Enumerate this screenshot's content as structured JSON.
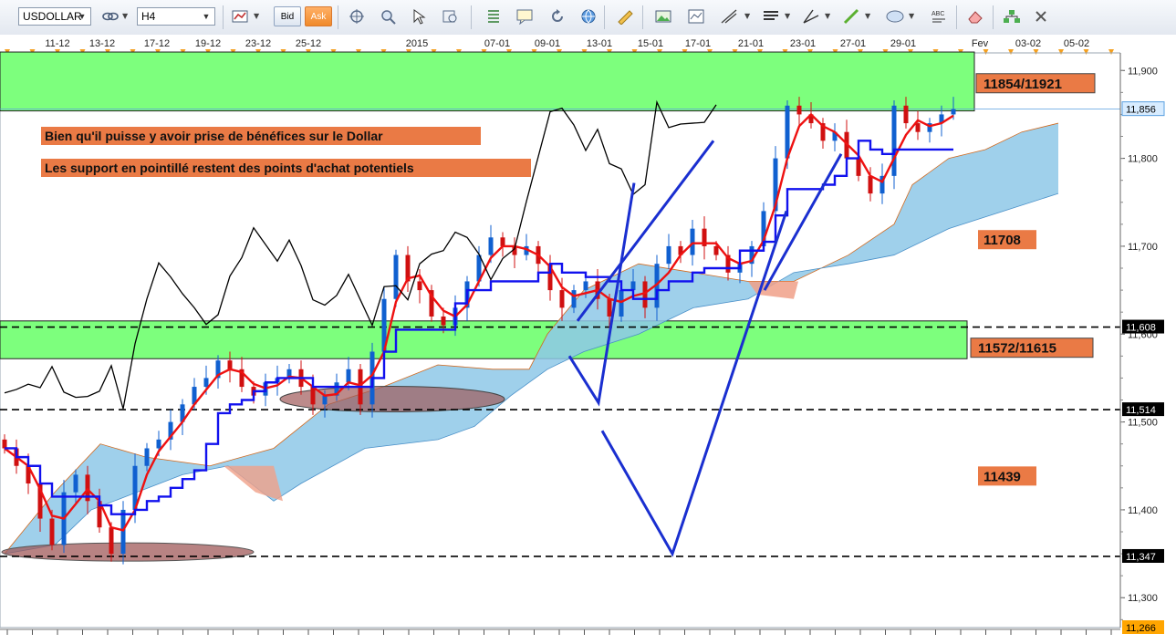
{
  "toolbar": {
    "symbol": "USDOLLAR",
    "timeframe": "H4",
    "bid_label": "Bid",
    "ask_label": "Ask",
    "icons": [
      "link-icon",
      "candles-icon",
      "crosshair-icon",
      "zoom-icon",
      "magnify-icon",
      "cursor-icon",
      "fibonacci-icon",
      "comment-icon",
      "refresh-icon",
      "globe-icon",
      "ruler-icon",
      "image-icon",
      "template-icon",
      "draw-lines-icon",
      "indicators-icon",
      "trendline-icon",
      "pencil-icon",
      "ellipse-icon",
      "text-icon",
      "eraser-icon",
      "hierarchy-icon",
      "close-icon"
    ]
  },
  "chart_data": {
    "type": "candlestick",
    "symbol": "USDOLLAR",
    "timeframe": "H4",
    "x_tick_labels": [
      "11-12",
      "13-12",
      "17-12",
      "19-12",
      "23-12",
      "25-12",
      "2015",
      "07-01",
      "09-01",
      "13-01",
      "15-01",
      "17-01",
      "21-01",
      "23-01",
      "27-01",
      "29-01",
      "Fev",
      "03-02",
      "05-02"
    ],
    "y_axis": {
      "min": 11266,
      "max": 11920,
      "ticks": [
        11900,
        11800,
        11700,
        11600,
        11500,
        11400,
        11300
      ]
    },
    "price_tags": [
      {
        "value": 11856,
        "label": "11,856",
        "style": "current"
      },
      {
        "value": 11608,
        "label": "11,608",
        "style": "level"
      },
      {
        "value": 11514,
        "label": "11,514",
        "style": "level"
      },
      {
        "value": 11347,
        "label": "11,347",
        "style": "level"
      },
      {
        "value": 11266,
        "label": "11,266",
        "style": "bottom"
      }
    ],
    "zones": [
      {
        "label": "11854/11921",
        "low": 11854,
        "high": 11921,
        "color": "#7dff7d"
      },
      {
        "label": "11572/11615",
        "low": 11572,
        "high": 11615,
        "color": "#7dff7d"
      }
    ],
    "dashed_levels": [
      11608,
      11514,
      11347
    ],
    "level_labels": [
      {
        "text": "11708",
        "value": 11708
      },
      {
        "text": "11439",
        "value": 11439
      }
    ],
    "annotations": [
      "Bien qu'il puisse y avoir prise de bénéfices sur le Dollar",
      "Les support en pointillé restent des points d'achat potentiels"
    ],
    "close_series": [
      11470,
      11450,
      11430,
      11390,
      11360,
      11420,
      11440,
      11410,
      11380,
      11350,
      11400,
      11450,
      11470,
      11480,
      11500,
      11520,
      11540,
      11550,
      11570,
      11560,
      11540,
      11530,
      11545,
      11550,
      11560,
      11540,
      11520,
      11530,
      11545,
      11560,
      11520,
      11580,
      11640,
      11690,
      11660,
      11650,
      11620,
      11610,
      11630,
      11660,
      11690,
      11710,
      11700,
      11690,
      11700,
      11680,
      11650,
      11630,
      11650,
      11660,
      11640,
      11620,
      11650,
      11660,
      11630,
      11680,
      11700,
      11690,
      11720,
      11700,
      11690,
      11670,
      11680,
      11700,
      11740,
      11800,
      11860,
      11850,
      11840,
      11820,
      11830,
      11800,
      11780,
      11760,
      11780,
      11860,
      11840,
      11830,
      11840,
      11850,
      11856
    ],
    "series": [
      {
        "name": "Tenkan-sen",
        "color": "#ee1111"
      },
      {
        "name": "Kijun-sen",
        "color": "#1111ee"
      },
      {
        "name": "Chikou span",
        "color": "#000000"
      },
      {
        "name": "Kumo",
        "color": "#8ec8e8"
      }
    ]
  }
}
